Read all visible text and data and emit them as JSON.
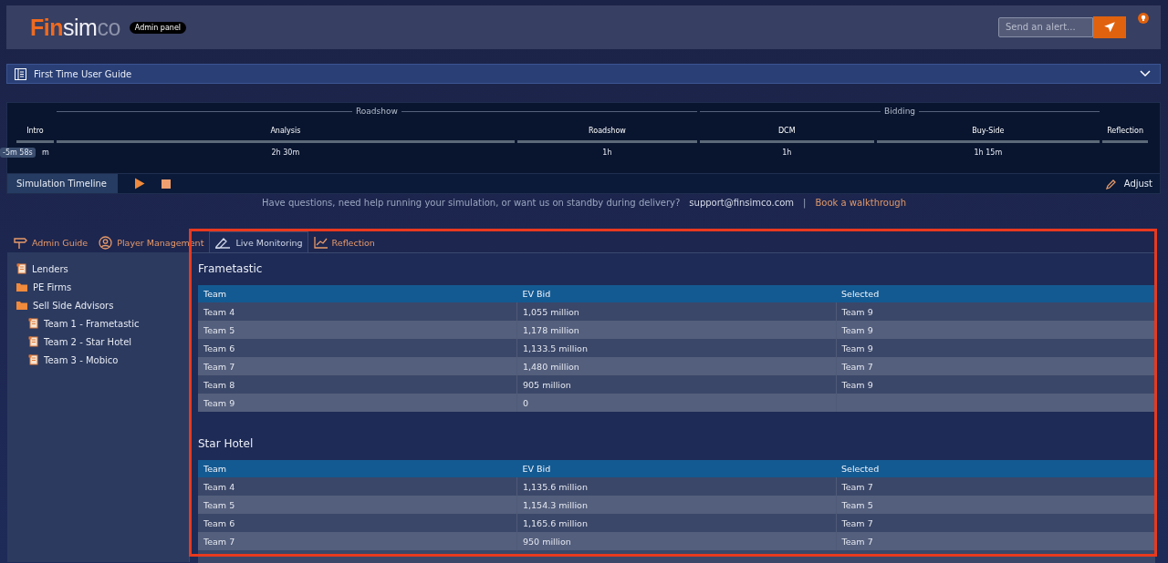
{
  "header": {
    "logo": {
      "accent": "Fin",
      "rest": "sim",
      "faded": "co"
    },
    "badge": "Admin panel",
    "alert": {
      "placeholder": "Send an alert..."
    }
  },
  "guide": {
    "title": "First Time User Guide",
    "expanded": false
  },
  "timeline": {
    "clock": "-5m 58s",
    "stages": [
      {
        "segments": [
          {
            "label": "Intro",
            "duration": "m"
          }
        ]
      },
      {
        "group": "Roadshow",
        "segments": [
          {
            "label": "Analysis",
            "duration": "2h 30m"
          },
          {
            "label": "Roadshow",
            "duration": "1h"
          }
        ]
      },
      {
        "group": "Bidding",
        "segments": [
          {
            "label": "DCM",
            "duration": "1h"
          },
          {
            "label": "Buy-Side",
            "duration": "1h 15m"
          }
        ]
      },
      {
        "segments": [
          {
            "label": "Reflection"
          }
        ]
      }
    ],
    "bar_title": "Simulation Timeline",
    "adjust": "Adjust"
  },
  "help": {
    "text": "Have questions, need help running your simulation, or want us on standby during delivery?",
    "email": "support@finsimco.com",
    "separator": "|",
    "link": "Book a walkthrough"
  },
  "tabs": [
    {
      "label": "Admin Guide",
      "selected": false
    },
    {
      "label": "Player Management",
      "selected": false
    },
    {
      "label": "Live Monitoring",
      "selected": true
    },
    {
      "label": "Reflection",
      "selected": false
    }
  ],
  "tree": [
    {
      "label": "Lenders",
      "kind": "document"
    },
    {
      "label": "PE Firms",
      "kind": "folder"
    },
    {
      "label": "Sell Side Advisors",
      "kind": "folder",
      "children": [
        {
          "label": "Team 1 - Frametastic",
          "kind": "document"
        },
        {
          "label": "Team 2 - Star Hotel",
          "kind": "document"
        },
        {
          "label": "Team 3 - Mobico",
          "kind": "document"
        }
      ]
    }
  ],
  "sections": [
    {
      "title": "Frametastic",
      "columns": [
        "Team",
        "EV Bid",
        "Selected"
      ],
      "rows": [
        [
          "Team 4",
          "1,055 million",
          "Team 9"
        ],
        [
          "Team 5",
          "1,178 million",
          "Team 9"
        ],
        [
          "Team 6",
          "1,133.5 million",
          "Team 9"
        ],
        [
          "Team 7",
          "1,480 million",
          "Team 7"
        ],
        [
          "Team 8",
          "905 million",
          "Team 9"
        ],
        [
          "Team 9",
          "0",
          ""
        ]
      ]
    },
    {
      "title": "Star Hotel",
      "columns": [
        "Team",
        "EV Bid",
        "Selected"
      ],
      "rows": [
        [
          "Team 4",
          "1,135.6 million",
          "Team 7"
        ],
        [
          "Team 5",
          "1,154.3 million",
          "Team 5"
        ],
        [
          "Team 6",
          "1,165.6 million",
          "Team 7"
        ],
        [
          "Team 7",
          "950 million",
          "Team 7"
        ]
      ]
    }
  ]
}
